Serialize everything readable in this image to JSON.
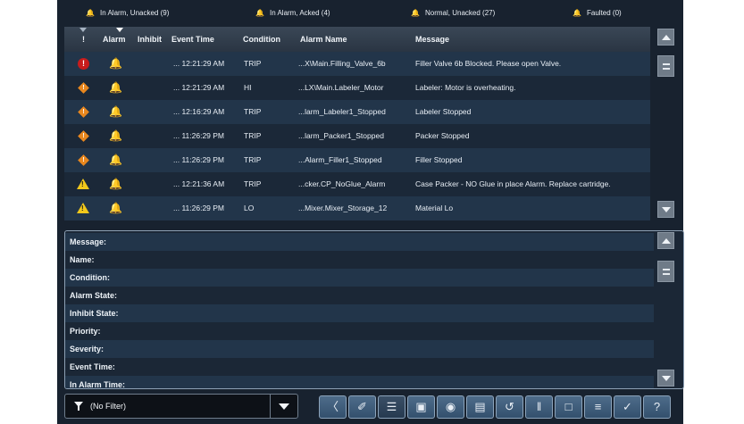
{
  "status_bar": [
    {
      "label": "In Alarm, Unacked (9)",
      "icon": "bell-icon"
    },
    {
      "label": "In Alarm, Acked (4)",
      "icon": "bell-icon"
    },
    {
      "label": "Normal, Unacked (27)",
      "icon": "bell-outline-icon"
    },
    {
      "label": "Faulted (0)",
      "icon": "bell-fault-icon"
    }
  ],
  "columns": {
    "priority": "!",
    "alarm": "Alarm",
    "inhibit": "Inhibit",
    "event_time": "Event Time",
    "condition": "Condition",
    "alarm_name": "Alarm Name",
    "message": "Message"
  },
  "rows": [
    {
      "severity": "critical",
      "severity_glyph": "!",
      "bell": "red",
      "inhibit": "",
      "event_time": "... 12:21:29 AM",
      "condition": "TRIP",
      "alarm_name": "...X\\Main.Filling_Valve_6b",
      "message": "Filler Valve 6b Blocked. Please open Valve."
    },
    {
      "severity": "high",
      "severity_glyph": "!",
      "bell": "white",
      "inhibit": "",
      "event_time": "... 12:21:29 AM",
      "condition": "HI",
      "alarm_name": "...LX\\Main.Labeler_Motor",
      "message": "Labeler: Motor is overheating."
    },
    {
      "severity": "high",
      "severity_glyph": "!",
      "bell": "white",
      "inhibit": "",
      "event_time": "... 12:16:29 AM",
      "condition": "TRIP",
      "alarm_name": "...larm_Labeler1_Stopped",
      "message": "Labeler Stopped"
    },
    {
      "severity": "high",
      "severity_glyph": "!",
      "bell": "white",
      "inhibit": "",
      "event_time": "... 11:26:29 PM",
      "condition": "TRIP",
      "alarm_name": "...larm_Packer1_Stopped",
      "message": "Packer Stopped"
    },
    {
      "severity": "high",
      "severity_glyph": "!",
      "bell": "white",
      "inhibit": "",
      "event_time": "... 11:26:29 PM",
      "condition": "TRIP",
      "alarm_name": "...Alarm_Filler1_Stopped",
      "message": "Filler Stopped"
    },
    {
      "severity": "medium",
      "severity_glyph": "!",
      "bell": "white",
      "inhibit": "",
      "event_time": "... 12:21:36 AM",
      "condition": "TRIP",
      "alarm_name": "...cker.CP_NoGlue_Alarm",
      "message": "Case Packer - NO Glue in place Alarm. Replace cartridge."
    },
    {
      "severity": "medium",
      "severity_glyph": "!",
      "bell": "white",
      "inhibit": "",
      "event_time": "... 11:26:29 PM",
      "condition": "LO",
      "alarm_name": "...Mixer.Mixer_Storage_12",
      "message": "Material Lo"
    }
  ],
  "details": [
    "Message:",
    "Name:",
    "Condition:",
    "Alarm State:",
    "Inhibit State:",
    "Priority:",
    "Severity:",
    "Event Time:",
    "In Alarm Time:"
  ],
  "filter": {
    "value": "(No Filter)"
  },
  "toolbar": [
    {
      "name": "previous-button",
      "glyph": "〈"
    },
    {
      "name": "properties-button",
      "glyph": "✐"
    },
    {
      "name": "details-button",
      "glyph": "☰"
    },
    {
      "name": "ack-selected-button",
      "glyph": "▣"
    },
    {
      "name": "ack-all-button",
      "glyph": "◉"
    },
    {
      "name": "shelve-button",
      "glyph": "▤"
    },
    {
      "name": "reset-button",
      "glyph": "↺"
    },
    {
      "name": "suppress-button",
      "glyph": "‖"
    },
    {
      "name": "disable-button",
      "glyph": "□"
    },
    {
      "name": "sort-button",
      "glyph": "≡"
    },
    {
      "name": "confirm-button",
      "glyph": "✓"
    },
    {
      "name": "help-button",
      "glyph": "?"
    }
  ],
  "colors": {
    "panel": "#18222f",
    "row_alt": "#22354a",
    "critical": "#c71c1c",
    "high": "#e8871e",
    "medium": "#f2c81b"
  }
}
